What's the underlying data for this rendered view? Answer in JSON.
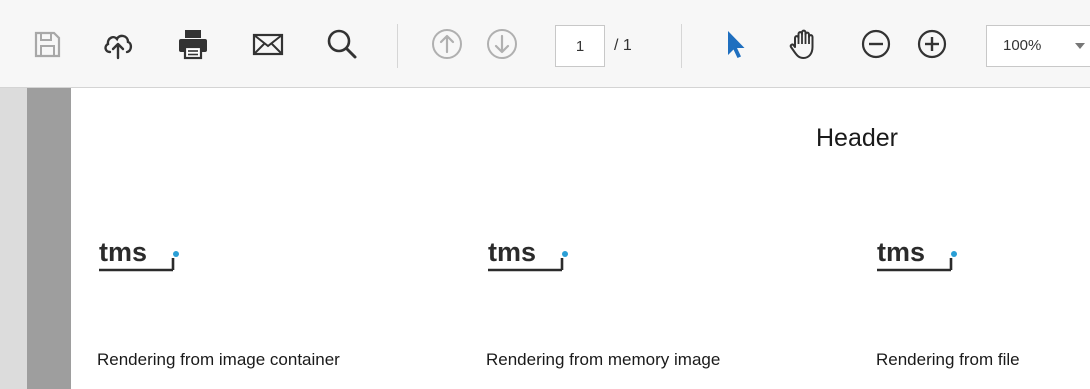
{
  "toolbar": {
    "icons": [
      "save-icon",
      "cloud-upload-icon",
      "print-icon",
      "email-icon",
      "search-icon",
      "previous-page-icon",
      "next-page-icon",
      "select-cursor-icon",
      "hand-pan-icon",
      "zoom-out-icon",
      "zoom-in-icon"
    ],
    "page_current": "1",
    "page_total": "/ 1",
    "zoom_value": "100%",
    "active_tool_color": "#1f6fbf"
  },
  "document": {
    "header": "Header",
    "logo_text": "tms",
    "logo_accent_color": "#2a9fd6",
    "images": [
      {
        "caption": "Rendering from image container"
      },
      {
        "caption": "Rendering from memory image"
      },
      {
        "caption": "Rendering from file"
      }
    ]
  }
}
